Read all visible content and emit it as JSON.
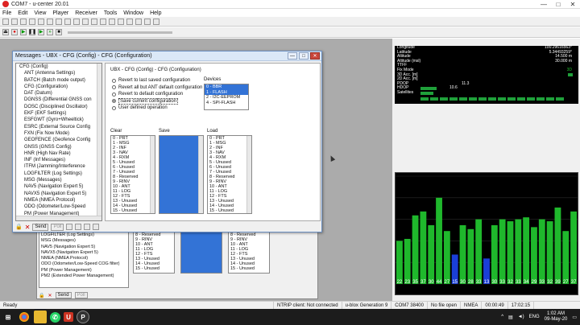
{
  "window": {
    "title": "COM7 - u-center 20.01",
    "min": "—",
    "max": "□",
    "close": "✕"
  },
  "menu": [
    "File",
    "Edit",
    "View",
    "Player",
    "Receiver",
    "Tools",
    "Window",
    "Help"
  ],
  "dialog": {
    "title": "Messages - UBX - CFG (Config) - CFG (Configuration)",
    "panel_header": "UBX - CFG (Config) - CFG (Configuration)",
    "tree": [
      "CFG (Config)",
      "ANT (Antenna Settings)",
      "BATCH (Batch mode output)",
      "CFG (Configuration)",
      "DAT (Datum)",
      "DGNSS (Differential GNSS con",
      "DOSC (Disciplined Oscillator)",
      "EKF (EKF Settings)",
      "ESFGWT (Gyro+Wheeltick)",
      "ESRC (External Source Config",
      "FXN (Fix Now Mode)",
      "GEOFENCE (Geofence Config",
      "GNSS (GNSS Config)",
      "HNR (High Nav Rate)",
      "INF (Inf Messages)",
      "ITFM (Jamming/Interference",
      "LOGFILTER (Log Settings)",
      "MSG (Messages)",
      "NAV5 (Navigation Expert 5)",
      "NAVX5 (Navigation Expert 5)",
      "NMEA (NMEA Protocol)",
      "ODO (Odometer/Low-Speed",
      "PM (Power Management)"
    ],
    "options": [
      {
        "label": "Revert to last saved configuration",
        "checked": false
      },
      {
        "label": "Revert all but ANT default configuration",
        "checked": false
      },
      {
        "label": "Revert to default configuration",
        "checked": false
      },
      {
        "label": "Save current configuration",
        "checked": true
      },
      {
        "label": "User defined operation",
        "checked": false
      }
    ],
    "devices_label": "Devices",
    "devices": [
      "0 - BBR",
      "1 - FLASH",
      "2 - I2C-EEPROM",
      "4 - SPI-FLASH"
    ],
    "devices_selected": [
      0,
      1
    ],
    "clear_label": "Clear",
    "save_label": "Save",
    "load_label": "Load",
    "config_items": [
      "0 - PRT",
      "1 - MSG",
      "2 - INF",
      "3 - NAV",
      "4 - RXM",
      "5 - Unused",
      "6 - Unused",
      "7 - Unused",
      "8 - Reserved",
      "9 - RINV",
      "10 - ANT",
      "11 - LOG",
      "12 - FTS",
      "13 - Unused",
      "14 - Unused",
      "15 - Unused"
    ],
    "footer": {
      "send": "Send",
      "poll": "Poll"
    }
  },
  "bg_list": [
    "LOGFILTER (Log Settings)",
    "MSG (Messages)",
    "NAV5 (Navigation Expert 5)",
    "NAVX5 (Navigation Expert 5)",
    "NMEA (NMEA Protocol)",
    "ODO (Odometer/Low-Speed COG filter)",
    "PM (Power Management)",
    "PM2 (Extended Power Management)"
  ],
  "bg_items": [
    "8 - Reserved",
    "9 - RINV",
    "10 - ANT",
    "11 - LOG",
    "12 - FTS",
    "13 - Unused",
    "14 - Unused",
    "15 - Unused"
  ],
  "bg_footer": {
    "send": "Send",
    "poll": "Poll"
  },
  "sky": [
    {
      "k": "Longitude",
      "v": "100.29616563°"
    },
    {
      "k": "Latitude",
      "v": "5.34493259°"
    },
    {
      "k": "Altitude",
      "v": "14.500 m"
    },
    {
      "k": "Altitude (msl)",
      "v": "30.000 m"
    },
    {
      "k": "TTFF",
      "v": ""
    },
    {
      "k": "Fix Mode",
      "v": "3D"
    },
    {
      "k": "3D Acc. [m]",
      "v": ""
    },
    {
      "k": "2D Acc. [m]",
      "v": ""
    },
    {
      "k": "PDOP",
      "v": "11.3"
    },
    {
      "k": "HDOP",
      "v": "10.6"
    },
    {
      "k": "Satellites",
      "v": ""
    }
  ],
  "chart_data": {
    "type": "bar",
    "title": "",
    "categories": [
      "22",
      "23",
      "35",
      "37",
      "30",
      "44",
      "27",
      "15",
      "30",
      "28",
      "33",
      "13",
      "30",
      "33",
      "32",
      "33",
      "34",
      "29",
      "33",
      "32",
      "39",
      "27",
      "37"
    ],
    "values": [
      22,
      23,
      35,
      37,
      30,
      44,
      27,
      15,
      30,
      28,
      33,
      13,
      30,
      33,
      32,
      33,
      34,
      29,
      33,
      32,
      39,
      27,
      37
    ],
    "colors": [
      "#1fb82c",
      "#1fb82c",
      "#1fb82c",
      "#1fb82c",
      "#1fb82c",
      "#1fb82c",
      "#1fb82c",
      "#1a3fd8",
      "#1fb82c",
      "#1fb82c",
      "#1fb82c",
      "#1a3fd8",
      "#1fb82c",
      "#1fb82c",
      "#1fb82c",
      "#1fb82c",
      "#1fb82c",
      "#1fb82c",
      "#1fb82c",
      "#1fb82c",
      "#1fb82c",
      "#1fb82c",
      "#1fb82c"
    ],
    "ylim": [
      0,
      55
    ],
    "grid": true,
    "legend": "none"
  },
  "status": {
    "ready": "Ready",
    "ntrip": "NTRIP client: Not connected",
    "gen": "u-blox Generation 9",
    "port": "COM7 38400",
    "file": "No file open",
    "proto": "NMEA",
    "time1": "00:00:49",
    "time2": "17:02:15"
  },
  "taskbar": {
    "lang": "ENG",
    "time": "1:02 AM",
    "date": "09-May-20"
  },
  "colors": {
    "accent": "#3373d6",
    "sat_green": "#1fb82c",
    "sat_blue": "#1a3fd8",
    "taskbar": "#1c1c1c"
  }
}
